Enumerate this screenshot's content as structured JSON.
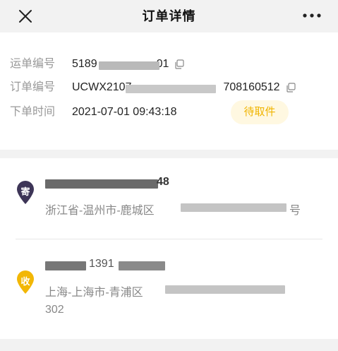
{
  "header": {
    "title": "订单详情"
  },
  "order_info": {
    "waybill_label": "运单编号",
    "waybill_value": "5189",
    "waybill_tail": "01",
    "order_label": "订单编号",
    "order_value": "UCWX2107",
    "order_tail": "708160512",
    "time_label": "下单时间",
    "time_value": "2021-07-01 09:43:18",
    "status": "待取件"
  },
  "sender": {
    "badge": "寄",
    "name_tail": "48",
    "region": "浙江省-温州市-鹿城区",
    "address_tail": "号"
  },
  "receiver": {
    "badge": "收",
    "phone_part": "1391",
    "region": "上海-上海市-青浦区",
    "address_line2": "302"
  },
  "colors": {
    "sender_badge": "#3d3557",
    "receiver_badge": "#f2b705",
    "status_text": "#f0b400",
    "status_bg": "#fff8e1"
  }
}
